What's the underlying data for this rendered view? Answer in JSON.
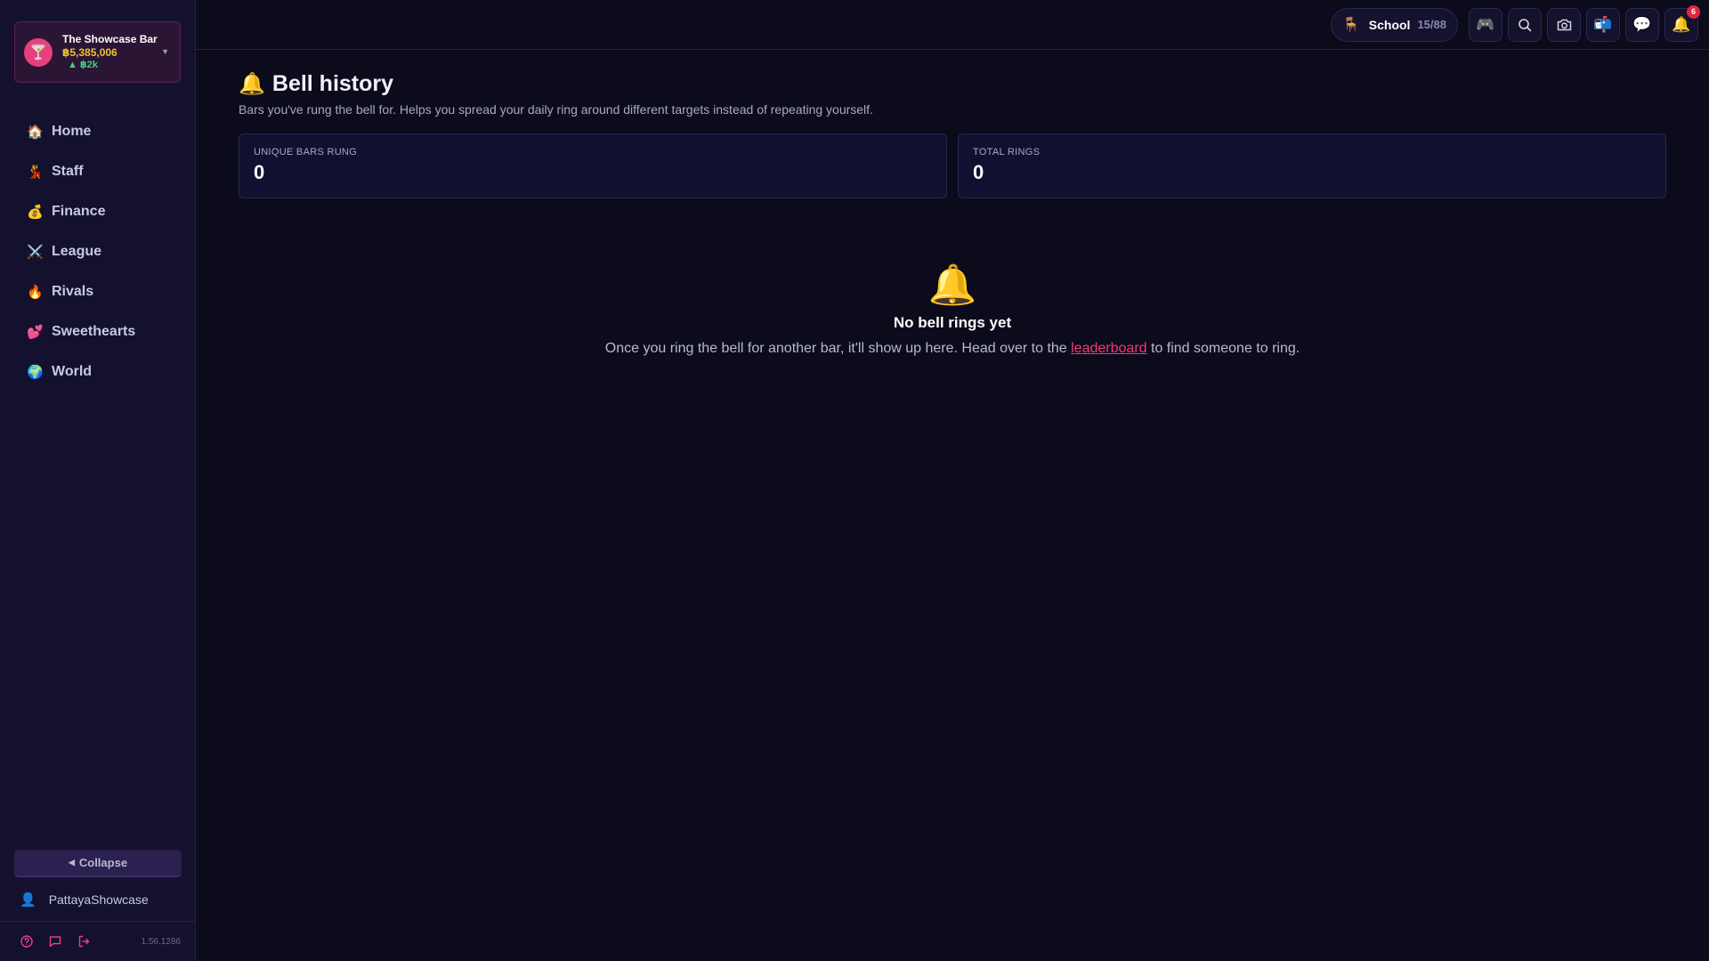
{
  "bar": {
    "name": "The Showcase Bar",
    "money": "฿5,385,006",
    "trend": "▲ ฿2k",
    "avatar_icon": "cocktail-icon"
  },
  "nav": [
    {
      "label": "Home",
      "icon": "🏠",
      "icon_name": "house-icon"
    },
    {
      "label": "Staff",
      "icon": "💃",
      "icon_name": "dancer-icon"
    },
    {
      "label": "Finance",
      "icon": "💰",
      "icon_name": "money-bag-icon"
    },
    {
      "label": "League",
      "icon": "⚔️",
      "icon_name": "crossed-swords-icon"
    },
    {
      "label": "Rivals",
      "icon": "🔥",
      "icon_name": "fire-icon"
    },
    {
      "label": "Sweethearts",
      "icon": "💕",
      "icon_name": "hearts-icon"
    },
    {
      "label": "World",
      "icon": "🌍",
      "icon_name": "globe-icon"
    }
  ],
  "sidebar_bottom": {
    "collapse_label": "Collapse",
    "username": "PattayaShowcase",
    "version": "1.56.1286"
  },
  "topbar": {
    "school_label": "School",
    "school_count": "15/88",
    "notification_count": "6"
  },
  "page": {
    "title": "Bell history",
    "subtitle": "Bars you've rung the bell for. Helps you spread your daily ring around different targets instead of repeating yourself."
  },
  "stats": [
    {
      "label": "UNIQUE BARS RUNG",
      "value": "0"
    },
    {
      "label": "TOTAL RINGS",
      "value": "0"
    }
  ],
  "empty": {
    "title": "No bell rings yet",
    "text_before": "Once you ring the bell for another bar, it'll show up here. Head over to the ",
    "link": "leaderboard",
    "text_after": " to find someone to ring."
  },
  "colors": {
    "accent": "#e8407e",
    "money": "#f1c232",
    "trend_up": "#3ed27a",
    "background": "#0b0b1c",
    "sidebar": "#13112e"
  }
}
